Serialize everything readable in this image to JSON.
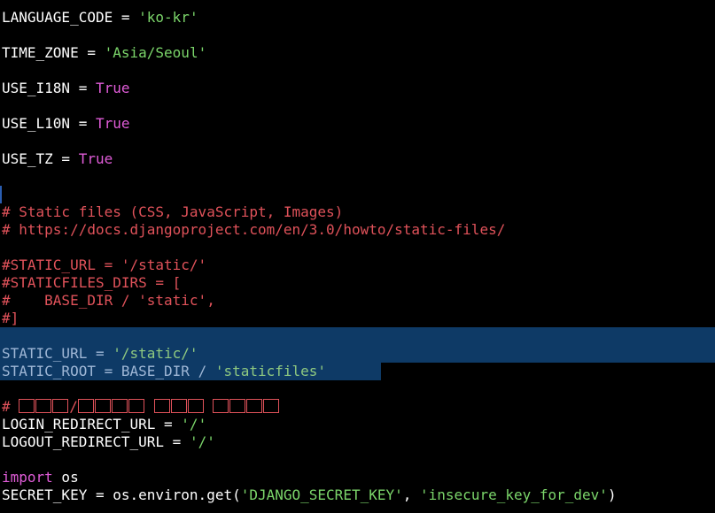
{
  "lines": {
    "l1": {
      "name": "LANGUAGE_CODE",
      "op": " = ",
      "val": "'ko-kr'"
    },
    "l2": {
      "name": "TIME_ZONE",
      "op": " = ",
      "val": "'Asia/Seoul'"
    },
    "l3": {
      "name": "USE_I18N",
      "op": " = ",
      "val": "True"
    },
    "l4": {
      "name": "USE_L10N",
      "op": " = ",
      "val": "True"
    },
    "l5": {
      "name": "USE_TZ",
      "op": " = ",
      "val": "True"
    },
    "c1": "# Static files (CSS, JavaScript, Images)",
    "c2": "# https://docs.djangoproject.com/en/3.0/howto/static-files/",
    "c3": "#STATIC_URL = '/static/'",
    "c4": "#STATICFILES_DIRS = [",
    "c5": "#    BASE_DIR / 'static',",
    "c6": "#]",
    "s1": {
      "name": "STATIC_URL",
      "op": " = ",
      "val": "'/static/'"
    },
    "s2": {
      "name": "STATIC_ROOT",
      "op": " = BASE_DIR / ",
      "val": "'staticfiles'"
    },
    "c7": "# ",
    "r1": {
      "name": "LOGIN_REDIRECT_URL",
      "op": " = ",
      "val": "'/'"
    },
    "r2": {
      "name": "LOGOUT_REDIRECT_URL",
      "op": " = ",
      "val": "'/'"
    },
    "i1": {
      "kw": "import",
      "rest": " os"
    },
    "k1": {
      "name": "SECRET_KEY",
      "op": " = os.environ.get(",
      "val1": "'DJANGO_SECRET_KEY'",
      "sep": ", ",
      "val2": "'insecure_key_for_dev'",
      "end": ")"
    }
  },
  "colors": {
    "background": "#000000",
    "string": "#7bd56a",
    "keyword": "#e05cd8",
    "comment": "#e0525a",
    "selection": "#0e3a66"
  }
}
